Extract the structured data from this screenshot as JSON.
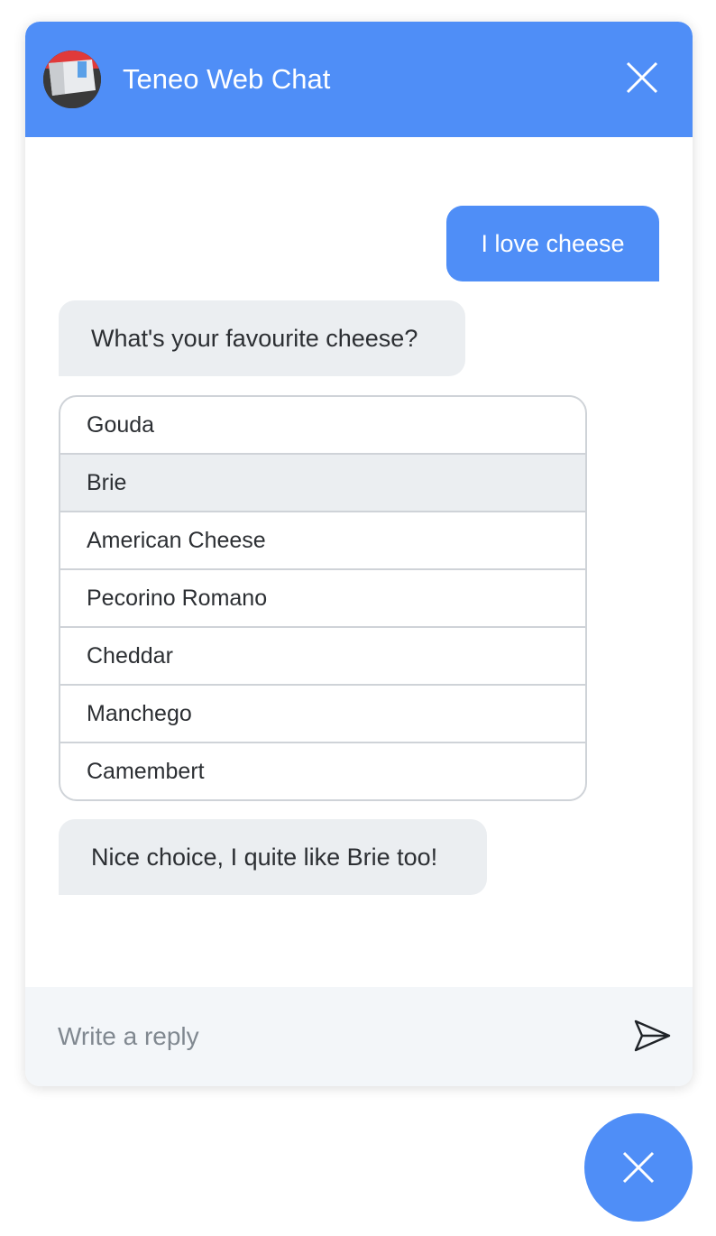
{
  "header": {
    "title": "Teneo Web Chat",
    "avatar_icon": "brand-avatar-icon",
    "close_icon": "close-icon",
    "background_color": "#4f8ef7"
  },
  "messages": [
    {
      "sender": "user",
      "text": "I love cheese"
    },
    {
      "sender": "bot",
      "text": "What's your favourite cheese?"
    },
    {
      "sender": "bot",
      "text": "Nice choice, I quite like Brie too!"
    }
  ],
  "options": {
    "items": [
      "Gouda",
      "Brie",
      "American Cheese",
      "Pecorino Romano",
      "Cheddar",
      "Manchego",
      "Camembert"
    ],
    "selected": "Brie"
  },
  "input": {
    "placeholder": "Write a reply",
    "value": "",
    "send_icon": "send-icon"
  },
  "launcher": {
    "icon": "close-icon"
  },
  "colors": {
    "accent": "#4f8ef7",
    "bot_bubble": "#ebeef1",
    "input_bar": "#f3f6f9",
    "text": "#2c2f33"
  }
}
